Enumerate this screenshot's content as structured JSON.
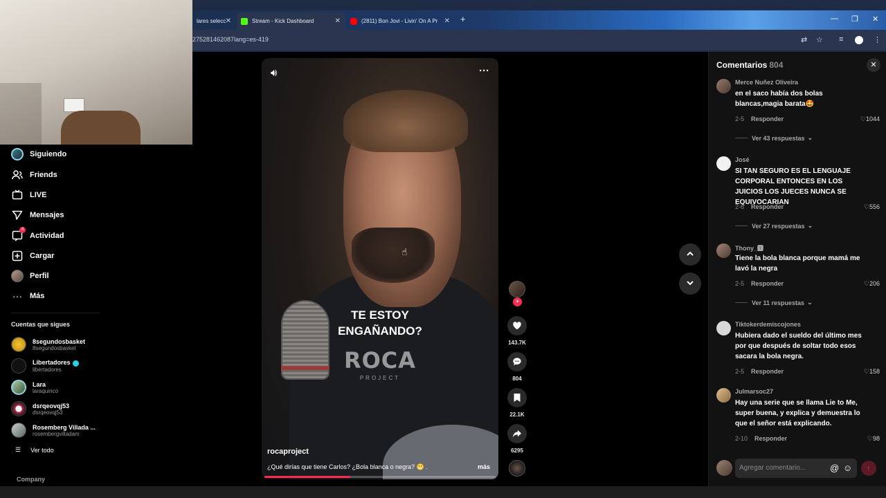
{
  "browser": {
    "tabs": [
      {
        "label": "lares selecc",
        "active": false
      },
      {
        "label": "Stream - Kick Dashboard",
        "active": true,
        "favicon_color": "#53fc18"
      },
      {
        "label": "(2811) Bon Jovi - Livin' On A Pr",
        "active": false,
        "favicon_color": "#ff0000"
      }
    ],
    "url": "275281462087lang=es-419"
  },
  "nav": {
    "items": [
      {
        "label": "Siguiendo",
        "icon": "avatar"
      },
      {
        "label": "Friends",
        "icon": "friends-icon"
      },
      {
        "label": "LIVE",
        "icon": "live-icon"
      },
      {
        "label": "Mensajes",
        "icon": "messages-icon"
      },
      {
        "label": "Actividad",
        "icon": "activity-icon",
        "badge": "4"
      },
      {
        "label": "Cargar",
        "icon": "upload-icon"
      },
      {
        "label": "Perfil",
        "icon": "avatar"
      },
      {
        "label": "Más",
        "icon": "more-icon"
      }
    ],
    "following_title": "Cuentas que sigues",
    "following": [
      {
        "name": "8segundosbasket",
        "handle": "8segundosbasket",
        "verified": false,
        "color": "#f4c430"
      },
      {
        "name": "Libertadores",
        "handle": "libertadores",
        "verified": true,
        "color": "#1c1c1c"
      },
      {
        "name": "Lara",
        "handle": "laraquirico",
        "verified": false,
        "color": "#6a8f6a"
      },
      {
        "name": "dsrqeovqj53",
        "handle": "dsrqeovqj53",
        "verified": false,
        "color": "#c2294a"
      },
      {
        "name": "Rosemberg Villada ...",
        "handle": "rosembergvilladam",
        "verified": false,
        "color": "#9aa3a0"
      }
    ],
    "see_all": "Ver todo",
    "company": "Company"
  },
  "video": {
    "overlay_title": "TE ESTOY ENGAÑANDO?",
    "logo_word": "ROCA",
    "logo_sub": "PROJECT",
    "author": "rocaproject",
    "caption": "¿Qué dirías que tiene Carlos? ¿Bola blanca o negra? 😬 .",
    "more": "más",
    "progress": 0.37
  },
  "actions": {
    "likes": "143.7K",
    "comments": "804",
    "saves": "22.1K",
    "shares": "6295"
  },
  "comments": {
    "title": "Comentarios",
    "count": "804",
    "placeholder": "Agregar comentario...",
    "list": [
      {
        "user": "Merce Nuñez Oliveira",
        "text": "en el saco había dos bolas blancas,magia barata🤩",
        "date": "2-5",
        "reply": "Responder",
        "likes": "1044",
        "replies": "Ver 43 respuestas",
        "avatar": "#7a5a4a"
      },
      {
        "user": "José",
        "text": "SI TAN SEGURO ES EL LENGUAJE CORPORAL ENTONCES EN LOS JUICIOS LOS JUECES NUNCA SE EQUIVOCARIAN",
        "date": "2-6",
        "reply": "Responder",
        "likes": "556",
        "replies": "Ver 27 respuestas",
        "avatar": "#f2f2f2"
      },
      {
        "user": "Thony_🆈",
        "text": "Tiene la bola blanca porque mamá me lavó la negra",
        "date": "2-5",
        "reply": "Responder",
        "likes": "206",
        "replies": "Ver 11 respuestas",
        "avatar": "#8a6a5a"
      },
      {
        "user": "Tiktokerdemiscojones",
        "text": "Hubiera dado el sueldo del último mes por que después de soltar todo esos sacara la bola negra.",
        "date": "2-5",
        "reply": "Responder",
        "likes": "158",
        "replies": "",
        "avatar": "#d8d8d8"
      },
      {
        "user": "Julmarsoc27",
        "text": "Hay una serie que se llama Lie to Me, super buena, y explica y demuestra lo que el señor está explicando.",
        "date": "2-10",
        "reply": "Responder",
        "likes": "98",
        "replies": "",
        "avatar": "#c9a27a"
      }
    ]
  }
}
